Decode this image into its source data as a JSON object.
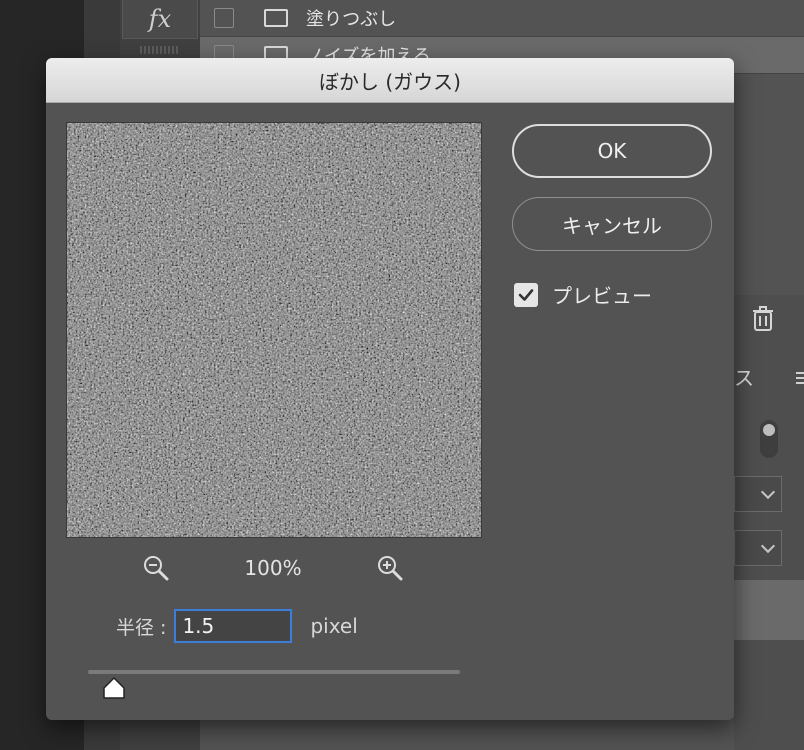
{
  "background": {
    "panel_rows": [
      {
        "label": "塗りつぶし"
      },
      {
        "label": "ノイズを加える"
      }
    ],
    "fx_label": "fx",
    "partial_tab_label": "ス"
  },
  "dialog": {
    "title": "ぼかし (ガウス)",
    "ok_label": "OK",
    "cancel_label": "キャンセル",
    "preview_checkbox": {
      "label": "プレビュー",
      "checked": true
    },
    "zoom_level": "100%",
    "radius": {
      "label": "半径 :",
      "value": "1.5",
      "unit": "pixel"
    }
  },
  "colors": {
    "dialog_bg": "#535353",
    "titlebar": "#e0e0e0",
    "focus_ring": "#3b7fd8"
  }
}
